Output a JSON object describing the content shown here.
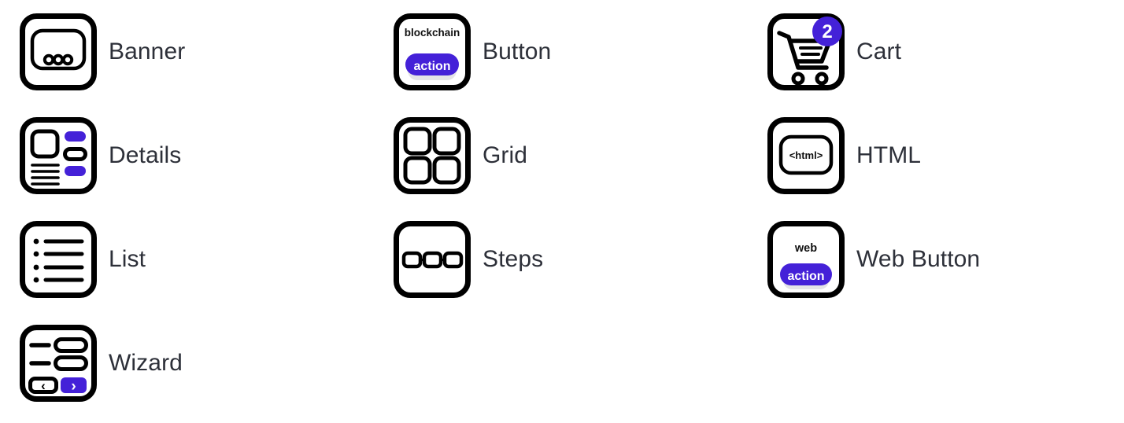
{
  "page": {
    "title": "Component Icon Legend",
    "background_color": "#ffffff",
    "accent_color": "#4421d8",
    "outline_color": "#000000",
    "label_color": "#2d3039",
    "shadow_color": "#e4e4e7",
    "columns": 3,
    "rows": 4
  },
  "legend": {
    "items": [
      {
        "id": "banner",
        "label": "Banner",
        "icon": "banner-icon",
        "icon_parts": [
          "rounded-frame",
          "inner-panel",
          "three-dots"
        ],
        "dots": 3
      },
      {
        "id": "button",
        "label": "Button",
        "icon": "button-icon",
        "caption_text": "blockchain",
        "pill_text": "action",
        "pill_color": "#4421d8",
        "shadow_color": "#e4e4e7"
      },
      {
        "id": "cart",
        "label": "Cart",
        "icon": "cart-icon",
        "badge_text": "2",
        "badge_color": "#4421d8"
      },
      {
        "id": "details",
        "label": "Details",
        "icon": "details-icon",
        "icon_parts": [
          "thumbnail-square",
          "text-lines",
          "purple-pill",
          "outline-pill",
          "purple-pill"
        ],
        "text_lines": 4,
        "accent_color": "#4421d8"
      },
      {
        "id": "grid",
        "label": "Grid",
        "icon": "grid-icon",
        "cells": 4
      },
      {
        "id": "html",
        "label": "HTML",
        "icon": "html-icon",
        "inner_text": "<html>"
      },
      {
        "id": "list",
        "label": "List",
        "icon": "list-icon",
        "rows": 4
      },
      {
        "id": "steps",
        "label": "Steps",
        "icon": "steps-icon",
        "steps": 3
      },
      {
        "id": "web-button",
        "label": "Web Button",
        "icon": "web-button-icon",
        "caption_text": "web",
        "pill_text": "action",
        "pill_color": "#4421d8",
        "shadow_color": "#e4e4e7"
      },
      {
        "id": "wizard",
        "label": "Wizard",
        "icon": "wizard-icon",
        "rows": 2,
        "prev_glyph": "‹",
        "next_glyph": "›",
        "next_color": "#4421d8"
      }
    ]
  }
}
